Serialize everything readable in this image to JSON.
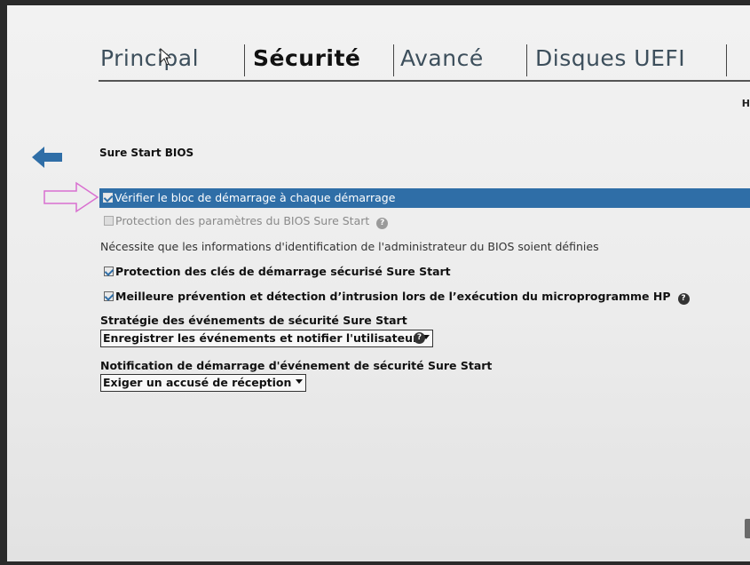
{
  "tabs": [
    {
      "label": "Principal",
      "active": false
    },
    {
      "label": "Sécurité",
      "active": true
    },
    {
      "label": "Avancé",
      "active": false
    },
    {
      "label": "Disques UEFI",
      "active": false
    }
  ],
  "corner_text": "H",
  "section_title": "Sure Start BIOS",
  "options": {
    "verify_boot_block": {
      "label": "Vérifier le bloc de démarrage à chaque démarrage",
      "checked": true,
      "selected": true
    },
    "bios_settings_protection": {
      "label": "Protection des paramètres du BIOS Sure Start",
      "checked": false,
      "disabled": true
    },
    "admin_note": "Nécessite que les informations d'identification de l'administrateur du BIOS soient définies",
    "secure_boot_keys": {
      "label": "Protection des clés de démarrage sécurisé Sure Start",
      "checked": true
    },
    "intrusion_prevention": {
      "label": "Meilleure prévention et détection d’intrusion lors de l’exécution du microprogramme HP",
      "checked": true
    }
  },
  "event_policy": {
    "label": "Stratégie des événements de sécurité Sure Start",
    "value": "Enregistrer les événements et notifier l'utilisateur"
  },
  "event_notification": {
    "label": "Notification de démarrage d'événement de sécurité Sure Start",
    "value": "Exiger un accusé de réception"
  },
  "colors": {
    "selection": "#2f6ea7",
    "annotation_arrow": "#d96fd0",
    "back_arrow": "#2f6ea7"
  }
}
